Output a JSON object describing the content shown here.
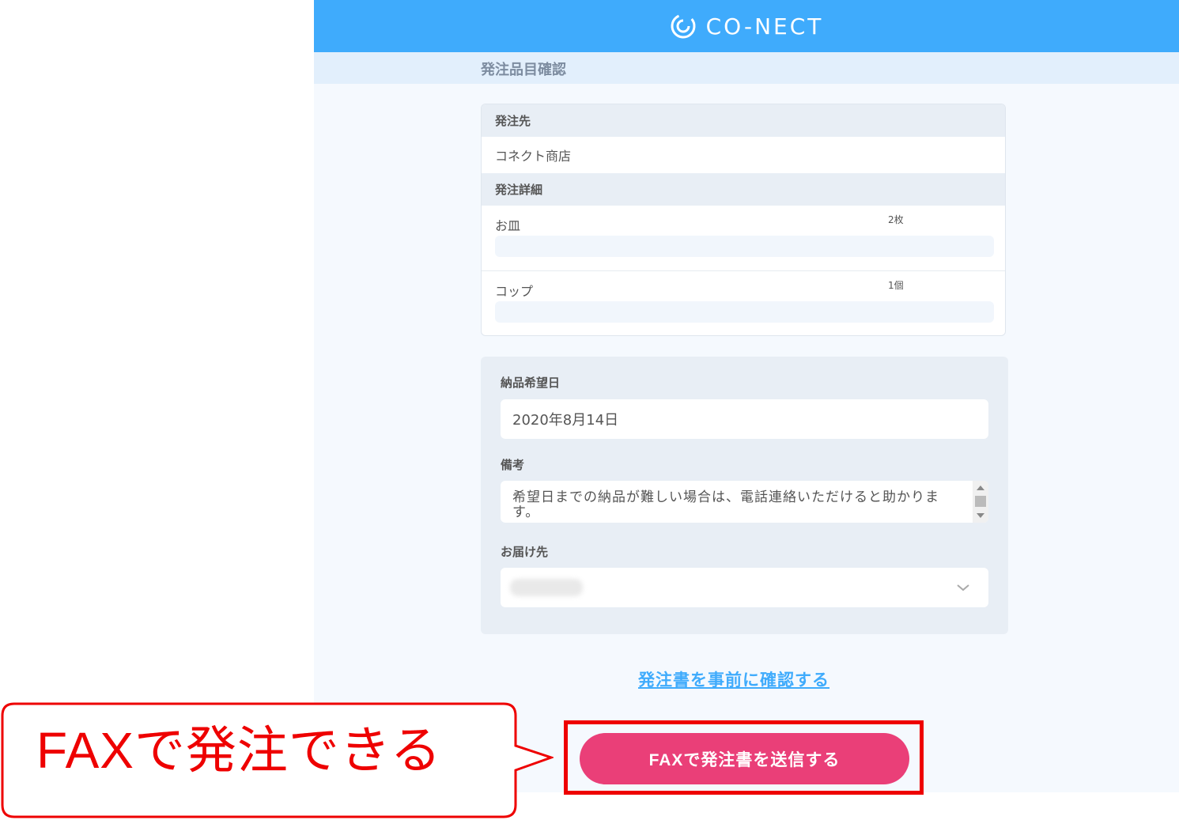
{
  "header": {
    "logo_text": "CO-NECT"
  },
  "subheader": {
    "title": "発注品目確認"
  },
  "order_card": {
    "supplier_heading": "発注先",
    "supplier_name": "コネクト商店",
    "details_heading": "発注詳細",
    "items": [
      {
        "name": "お皿",
        "quantity": "2枚"
      },
      {
        "name": "コップ",
        "quantity": "1個"
      }
    ]
  },
  "form": {
    "delivery_date_label": "納品希望日",
    "delivery_date_value": "2020年8月14日",
    "remarks_label": "備考",
    "remarks_value": "希望日までの納品が難しい場合は、電話連絡いただけると助かります。",
    "destination_label": "お届け先"
  },
  "actions": {
    "preview_link": "発注書を事前に確認する",
    "submit_button": "FAXで発注書を送信する"
  },
  "annotation": {
    "callout_text": "FAXで発注できる"
  },
  "colors": {
    "brand_blue": "#3fabfc",
    "submit_pink": "#ea3f78",
    "highlight_red": "#ee0000"
  }
}
